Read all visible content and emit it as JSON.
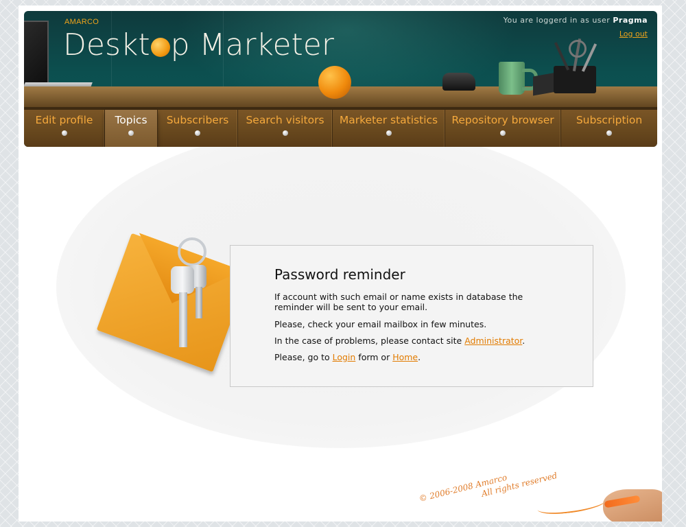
{
  "header": {
    "brand_small": "AMARCO",
    "brand_part1": "Deskt",
    "brand_part2": "p Marketer",
    "user_prefix": "You are loggerd in as user",
    "username": "Pragma",
    "logout_label": "Log out"
  },
  "nav": {
    "active": "Topics",
    "items": [
      {
        "label": "Edit profile"
      },
      {
        "label": "Topics"
      },
      {
        "label": "Subscribers"
      },
      {
        "label": "Search visitors"
      },
      {
        "label": "Marketer statistics"
      },
      {
        "label": "Repository browser"
      },
      {
        "label": "Subscription"
      }
    ]
  },
  "reminder": {
    "title": "Password reminder",
    "line1": "If account with such email or name exists in database the reminder will be sent to your email.",
    "line2": "Please, check your email mailbox in few minutes.",
    "line3_prefix": "In the case of problems, please contact site ",
    "admin_link": "Administrator",
    "line3_suffix": ".",
    "line4_prefix": "Please, go to ",
    "login_link": "Login",
    "line4_middle": " form or ",
    "home_link": "Home",
    "line4_suffix": "."
  },
  "footer": {
    "copyright_line1": "© 2006-2008 Amarco",
    "copyright_line2": "All rights reserved"
  },
  "colors": {
    "accent": "#e27b00",
    "nav_text": "#f5a93c",
    "header_teal": "#0c4f4f"
  }
}
